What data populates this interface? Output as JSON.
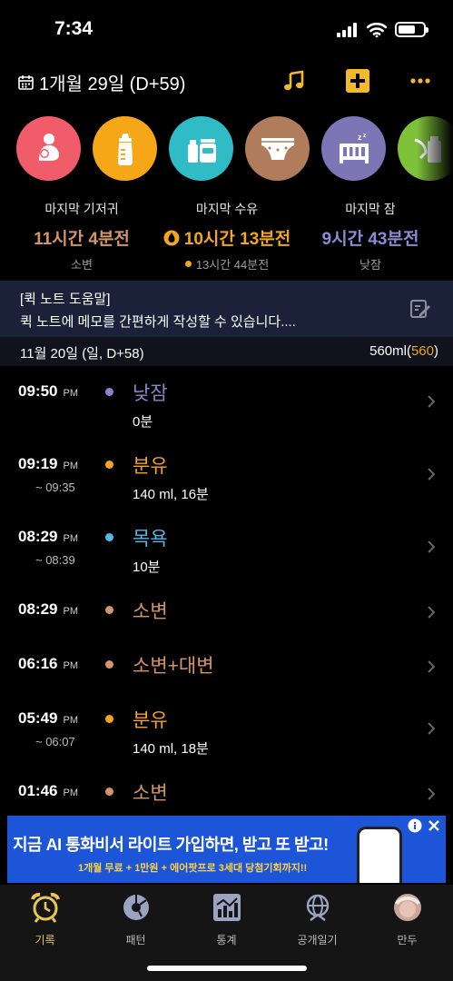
{
  "status_bar": {
    "time": "7:34"
  },
  "header": {
    "date": "1개월 29일 (D+59)",
    "icons": [
      "calendar-icon",
      "music-icon",
      "add-icon",
      "more-icon"
    ]
  },
  "categories": [
    {
      "name": "nursing",
      "icon": "breastfeeding-icon",
      "color": "#f05c6a"
    },
    {
      "name": "formula",
      "icon": "bottle-icon",
      "color": "#f6a718"
    },
    {
      "name": "baby-food",
      "icon": "food-jar-icon",
      "color": "#2fbcc6"
    },
    {
      "name": "diaper",
      "icon": "diaper-icon",
      "color": "#b07c5b"
    },
    {
      "name": "sleep",
      "icon": "crib-icon",
      "color": "#7e75b7"
    },
    {
      "name": "pumping",
      "icon": "pump-bottle-icon",
      "color": "#7fc23a"
    }
  ],
  "summary": {
    "diaper": {
      "label": "마지막 기저귀",
      "value": "11시간 4분전",
      "sub": "소변",
      "color": "#d49669"
    },
    "feeding": {
      "label": "마지막 수유",
      "value": "10시간 13분전",
      "sub": "13시간 44분전",
      "color": "#f2a51d"
    },
    "sleep": {
      "label": "마지막 잠",
      "value": "9시간 43분전",
      "sub": "낮잠",
      "color": "#9188d6"
    }
  },
  "quick_note": {
    "title": "[퀵 노트 도움말]",
    "text": "퀵 노트에 메모를 간편하게 작성할 수 있습니다...."
  },
  "day": {
    "title": "11월 20일 (일, D+58)",
    "total_prefix": "560ml(",
    "total_highlight": "560",
    "total_suffix": ")"
  },
  "records": [
    {
      "time": "09:50",
      "ampm": "PM",
      "end": "",
      "type": "낮잠",
      "detail": "0분",
      "color": "#8c84cf"
    },
    {
      "time": "09:19",
      "ampm": "PM",
      "end": "~ 09:35",
      "type": "분유",
      "detail": "140 ml, 16분",
      "color": "#f2a51d"
    },
    {
      "time": "08:29",
      "ampm": "PM",
      "end": "~ 08:39",
      "type": "목욕",
      "detail": "10분",
      "color": "#55b8e8"
    },
    {
      "time": "08:29",
      "ampm": "PM",
      "end": "",
      "type": "소변",
      "detail": "",
      "color": "#d49669"
    },
    {
      "time": "06:16",
      "ampm": "PM",
      "end": "",
      "type": "소변+대변",
      "detail": "",
      "color": "#d49669"
    },
    {
      "time": "05:49",
      "ampm": "PM",
      "end": "~ 06:07",
      "type": "분유",
      "detail": "140 ml, 18분",
      "color": "#f2a51d"
    },
    {
      "time": "01:46",
      "ampm": "PM",
      "end": "",
      "type": "소변",
      "detail": "",
      "color": "#d49669"
    }
  ],
  "ad": {
    "headline": "지금 AI 통화비서 라이트 가입하면, 받고 또 받고!",
    "sub": "1개월 무료 + 1만원 + 에어팟프로 3세대 당첨기회까지!!"
  },
  "tabbar": {
    "items": [
      {
        "label": "기록",
        "icon": "alarm-clock-icon",
        "active": true
      },
      {
        "label": "패턴",
        "icon": "pattern-chart-icon",
        "active": false
      },
      {
        "label": "통계",
        "icon": "stats-chart-icon",
        "active": false
      },
      {
        "label": "공개일기",
        "icon": "public-diary-icon",
        "active": false
      },
      {
        "label": "만두",
        "icon": "baby-avatar-icon",
        "active": false
      }
    ]
  },
  "colors": {
    "accent": "#f2a51d",
    "note_bg": "#1a2138",
    "ad_bg": "#1d55d8",
    "tab_active": "#e9c64f"
  }
}
